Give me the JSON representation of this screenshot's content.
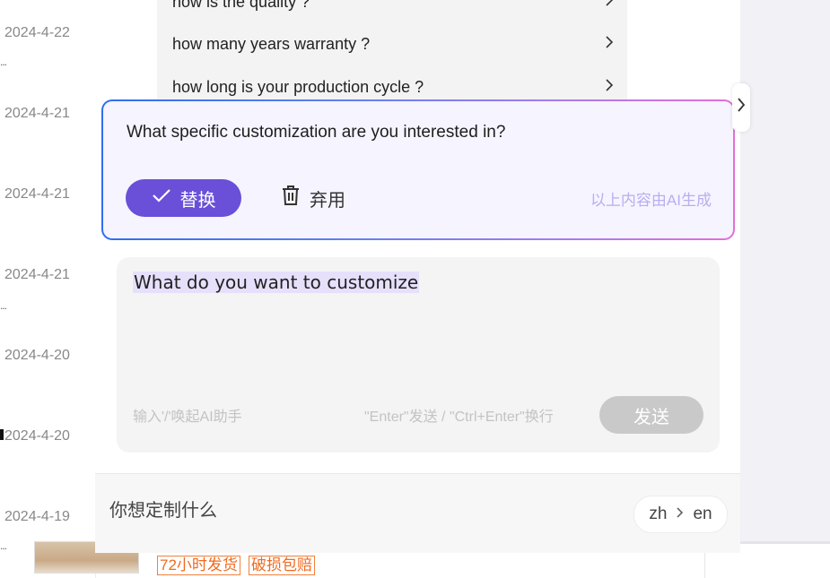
{
  "dates": [
    {
      "text": "2024-4-22",
      "dots": "..."
    },
    {
      "text": "2024-4-21",
      "dots": ""
    },
    {
      "text": "2024-4-21",
      "dots": ""
    },
    {
      "text": "2024-4-21",
      "dots": "..."
    },
    {
      "text": "2024-4-20",
      "dots": ""
    },
    {
      "text": "2024-4-20",
      "dots": ""
    },
    {
      "text": "2024-4-19",
      "dots": "..."
    }
  ],
  "faq": {
    "items": [
      "how is the quality ?",
      "how many years warranty ?",
      "how long is your production cycle ?"
    ]
  },
  "ai_suggestion": {
    "text": "What specific customization are you interested in?",
    "replace_label": "替换",
    "discard_label": "弃用",
    "note": "以上内容由AI生成"
  },
  "input": {
    "value": "What do you want to customize",
    "hint": "输入'/'唤起AI助手",
    "shortcut_hint": "\"Enter\"发送 / \"Ctrl+Enter\"换行",
    "send_label": "发送"
  },
  "translation": {
    "text": "你想定制什么",
    "from": "zh",
    "to": "en"
  },
  "product_tags": [
    "72小时发货",
    "破损包赔"
  ],
  "colors": {
    "accent": "#6a4fd8",
    "gradient_start": "#2f6ef0",
    "gradient_end": "#e46fd6",
    "tag_orange": "#f06a1e"
  }
}
